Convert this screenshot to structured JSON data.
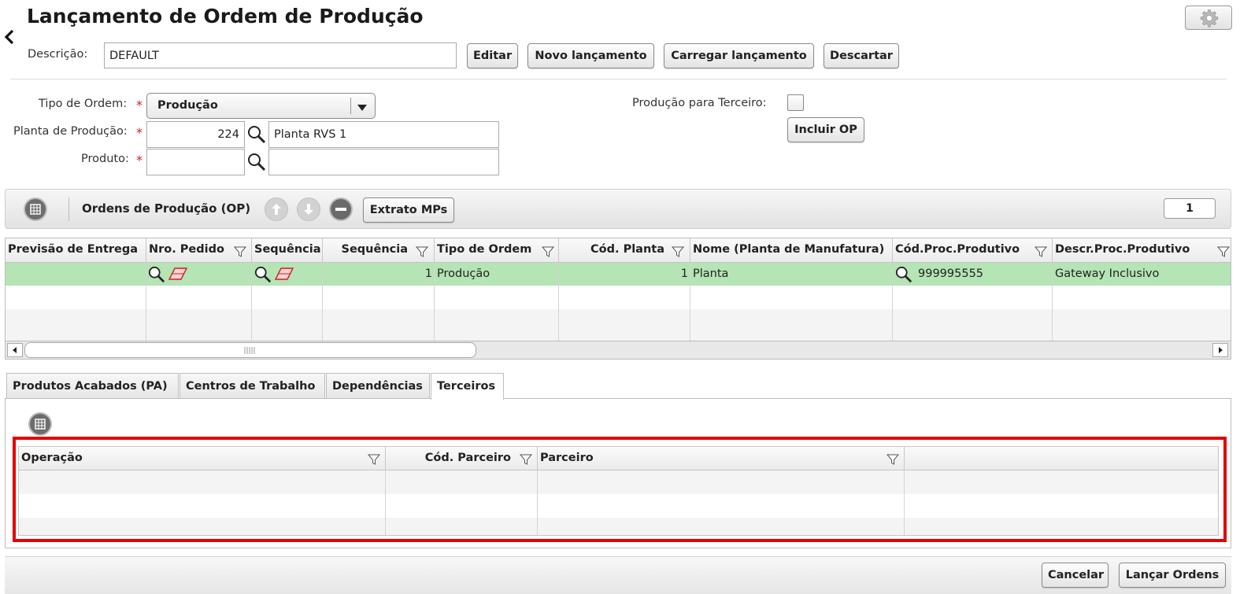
{
  "page": {
    "title": "Lançamento de Ordem de Produção"
  },
  "header": {
    "descricao_label": "Descrição:",
    "descricao_value": "DEFAULT",
    "buttons": {
      "editar": "Editar",
      "novo": "Novo lançamento",
      "carregar": "Carregar lançamento",
      "descartar": "Descartar"
    }
  },
  "form": {
    "tipo_ordem_label": "Tipo de Ordem:",
    "tipo_ordem_value": "Produção",
    "planta_label": "Planta de Produção:",
    "planta_code": "224",
    "planta_name": "Planta RVS 1",
    "produto_label": "Produto:",
    "produto_code": "",
    "produto_name": "",
    "terceiro_label": "Produção para Terceiro:",
    "incluir_op": "Incluir OP",
    "required_mark": "*"
  },
  "op_toolbar": {
    "title": "Ordens de Produção (OP)",
    "extrato": "Extrato MPs",
    "page_count": "1"
  },
  "op_grid": {
    "columns": [
      "Previsão de Entrega",
      "Nro. Pedido",
      "Sequência",
      "Sequência",
      "Tipo de Ordem",
      "Cód. Planta",
      "Nome (Planta de Manufatura)",
      "Cód.Proc.Produtivo",
      "Descr.Proc.Produtivo"
    ],
    "row": {
      "sequencia": "1",
      "tipo_ordem": "Produção",
      "cod_planta": "1",
      "nome_planta": "Planta",
      "cod_proc": "999995555",
      "descr_proc": "Gateway Inclusivo"
    }
  },
  "tabs": [
    "Produtos Acabados (PA)",
    "Centros de Trabalho",
    "Dependências",
    "Terceiros"
  ],
  "terceiros_grid": {
    "columns": [
      "Operação",
      "Cód. Parceiro",
      "Parceiro"
    ]
  },
  "footer": {
    "cancelar": "Cancelar",
    "lancar": "Lançar Ordens"
  },
  "colors": {
    "selected_row": "#b5e4b5",
    "highlight_border": "#e60000",
    "required": "#d81b1b"
  }
}
